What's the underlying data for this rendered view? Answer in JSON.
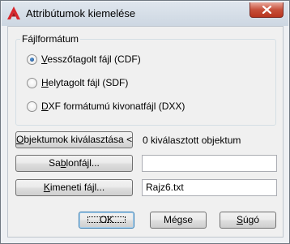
{
  "window": {
    "title": "Attribútumok kiemelése",
    "icon": "autocad-a-icon",
    "close_icon": "close-x-icon"
  },
  "file_format": {
    "group_label": "Fájlformátum",
    "options": [
      {
        "pre": "",
        "key": "V",
        "post": "esszőtagolt fájl (CDF)",
        "selected": true
      },
      {
        "pre": "",
        "key": "H",
        "post": "elytagolt fájl (SDF)",
        "selected": false
      },
      {
        "pre": "",
        "key": "D",
        "post": "XF formátumú kivonatfájl (DXX)",
        "selected": false
      }
    ]
  },
  "select_objects": {
    "button_pre": "",
    "button_key": "O",
    "button_post": "bjektumok kiválasztása <",
    "status": "0 kiválasztott objektum"
  },
  "template_file": {
    "button_pre": "Sa",
    "button_key": "b",
    "button_post": "lonfájl...",
    "value": ""
  },
  "output_file": {
    "button_pre": "",
    "button_key": "K",
    "button_post": "imeneti fájl...",
    "value": "Rajz6.txt"
  },
  "footer": {
    "ok_label": "OK",
    "cancel_label": "Mégse",
    "help_pre": "",
    "help_key": "S",
    "help_post": "úgó"
  },
  "colors": {
    "title_bar": "#dbe3ec",
    "close_button": "#c7503b",
    "default_button_border": "#3c7fb1",
    "radio_selected": "#17488a"
  }
}
